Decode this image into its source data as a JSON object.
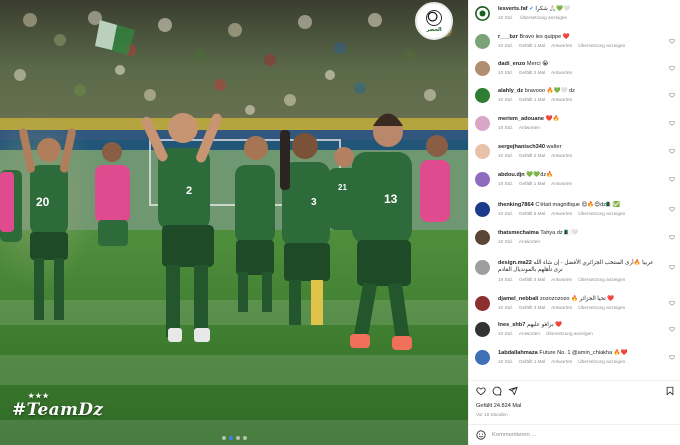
{
  "media": {
    "logo_text": "الخضر",
    "watermark": "#TeamDz",
    "watermark_stars": "★★★",
    "jersey_numbers": [
      "20",
      "2",
      "3",
      "13",
      "21"
    ],
    "carousel_dots": 4,
    "carousel_active": 1
  },
  "post": {
    "author": "lesverts.faf",
    "caption": "شكرا 🙏🏻💚🤍",
    "time": "10 Std.",
    "translate": "Übersetzung anzeigen"
  },
  "labels": {
    "reply": "Antworten",
    "translate": "Übersetzung anzeigen"
  },
  "comments": [
    {
      "user": "r___bzr",
      "text": "Bravo les quippe ❤️",
      "time": "10 Std.",
      "likes": "Gefällt 1 Mal",
      "translate": true,
      "avatar": "#7aa37a"
    },
    {
      "user": "dadi_enzo",
      "text": "Merci 😭",
      "time": "10 Std.",
      "likes": "Gefällt 2 Mal",
      "translate": false,
      "avatar": "#b08d6e"
    },
    {
      "user": "alahly_dz",
      "text": "bravooo 🔥💚🤍 dz",
      "time": "10 Std.",
      "likes": "Gefällt 1 Mal",
      "translate": false,
      "avatar": "#2e7d32"
    },
    {
      "user": "meriem_adouane",
      "text": "❤️🔥",
      "time": "10 Std.",
      "likes": "",
      "translate": false,
      "avatar": "#d9a6c8"
    },
    {
      "user": "sergejhanisch340",
      "text": "walter",
      "time": "10 Std.",
      "likes": "Gefällt 2 Mal",
      "translate": false,
      "avatar": "#e8c2a8"
    },
    {
      "user": "abdou.djn",
      "text": "💚💚dz🔥",
      "time": "10 Std.",
      "likes": "Gefällt 1 Mal",
      "translate": false,
      "avatar": "#8e6bbf"
    },
    {
      "user": "thenking7864",
      "text": "C'était magnifique 😍🔥😍dz🇩🇿✅",
      "time": "10 Std.",
      "likes": "Gefällt 5 Mal",
      "translate": true,
      "avatar": "#1e3a8a"
    },
    {
      "user": "thatsmechaima",
      "text": "Tahya dz 🇩🇿🤍",
      "time": "10 Std.",
      "likes": "",
      "translate": false,
      "avatar": "#5b4636"
    },
    {
      "user": "design.ma22",
      "text": "عربيا 🔥أرى المنتخب الجزائري الأفضل - إن شاء الله نرى تأهلهم بالمونديال القادم",
      "time": "10 Std.",
      "likes": "Gefällt 3 Mal",
      "translate": true,
      "avatar": "#9e9e9e"
    },
    {
      "user": "djamel_nebbali",
      "text": "zozozozozo 🔥 تحيا الجزائر ❤️",
      "time": "10 Std.",
      "likes": "Gefällt 3 Mal",
      "translate": true,
      "avatar": "#8b2f2f"
    },
    {
      "user": "lnes_shb7",
      "text": "برافو عليهم ❤️",
      "time": "10 Std.",
      "likes": "",
      "translate": true,
      "avatar": "#333333"
    },
    {
      "user": "1abdallahmaza",
      "text": "Future No. 1 @amin_chiakha 🔥❤️",
      "time": "10 Std.",
      "likes": "Gefällt 1 Mal",
      "translate": true,
      "avatar": "#3f6fb5"
    }
  ],
  "footer": {
    "likes": "Gefällt 24.824 Mal",
    "when": "Vor 10 Stunden",
    "placeholder": "Kommentieren ..."
  },
  "colors": {
    "link": "#00376b",
    "muted": "#8e8e8e",
    "text": "#262626",
    "jersey": "#2e6b3a",
    "pitch": "#3f7d2f"
  },
  "icons": [
    "like-heart-icon",
    "comment-icon",
    "share-icon",
    "bookmark-icon",
    "emoji-icon"
  ]
}
